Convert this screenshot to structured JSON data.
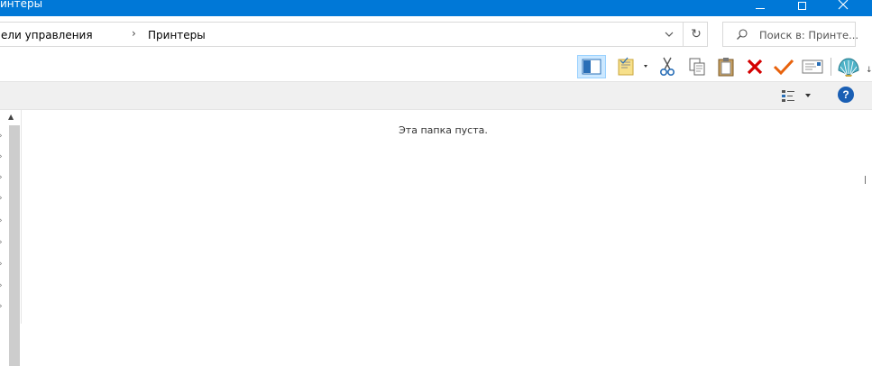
{
  "window": {
    "title": "интеры",
    "buttons": {
      "minimize": "minimize-icon",
      "maximize": "maximize-icon",
      "close": "close-icon"
    }
  },
  "address": {
    "crumbs": [
      "ели управления",
      "Принтеры"
    ],
    "separator": "›",
    "refresh_icon": "↻"
  },
  "search": {
    "placeholder": "Поиск в: Принте..."
  },
  "toolbar": {
    "icons": [
      "preview-pane-icon",
      "properties-icon",
      "cut-icon",
      "copy-icon",
      "paste-icon",
      "delete-icon",
      "check-icon",
      "mail-icon",
      "shell-icon"
    ]
  },
  "viewbar": {
    "help_label": "?"
  },
  "content": {
    "empty_message": "Эта папка пуста."
  },
  "colors": {
    "titlebar": "#0078d7",
    "selected": "#cce8ff",
    "delete": "#d40000",
    "check": "#e8620c"
  }
}
